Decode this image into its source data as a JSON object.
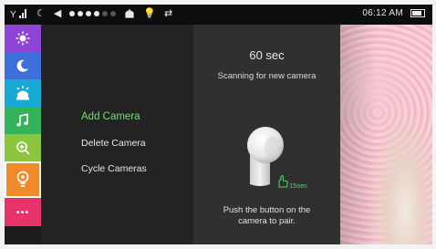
{
  "status_bar": {
    "icons_left": [
      "signal-icon",
      "moon-icon",
      "volume-dots",
      "monitor-icon",
      "bulb-icon",
      "repeat-icon"
    ],
    "time": "06:12 AM"
  },
  "sidebar": {
    "items": [
      {
        "name": "brightness",
        "icon": "brightness-icon",
        "color": "#8e44d4"
      },
      {
        "name": "night-mode",
        "icon": "moon-icon",
        "color": "#3d6fd8"
      },
      {
        "name": "monitor",
        "icon": "monitor-alert-icon",
        "color": "#17a9d4"
      },
      {
        "name": "music",
        "icon": "music-note-icon",
        "color": "#35b35a"
      },
      {
        "name": "zoom",
        "icon": "zoom-in-icon",
        "color": "#8cc63f"
      },
      {
        "name": "light",
        "icon": "bulb-icon",
        "color": "#f08a2a"
      },
      {
        "name": "more",
        "icon": "more-dots-icon",
        "color": "#e8326a"
      }
    ],
    "more_label": "•••"
  },
  "menu": {
    "items": [
      {
        "label": "Add Camera",
        "active": true
      },
      {
        "label": "Delete Camera",
        "active": false
      },
      {
        "label": "Cycle Cameras",
        "active": false
      }
    ]
  },
  "pairing": {
    "timer": "60 sec",
    "status": "Scanning for new camera",
    "hold_label": "15sec",
    "instruction": "Push the button on the camera to pair."
  }
}
